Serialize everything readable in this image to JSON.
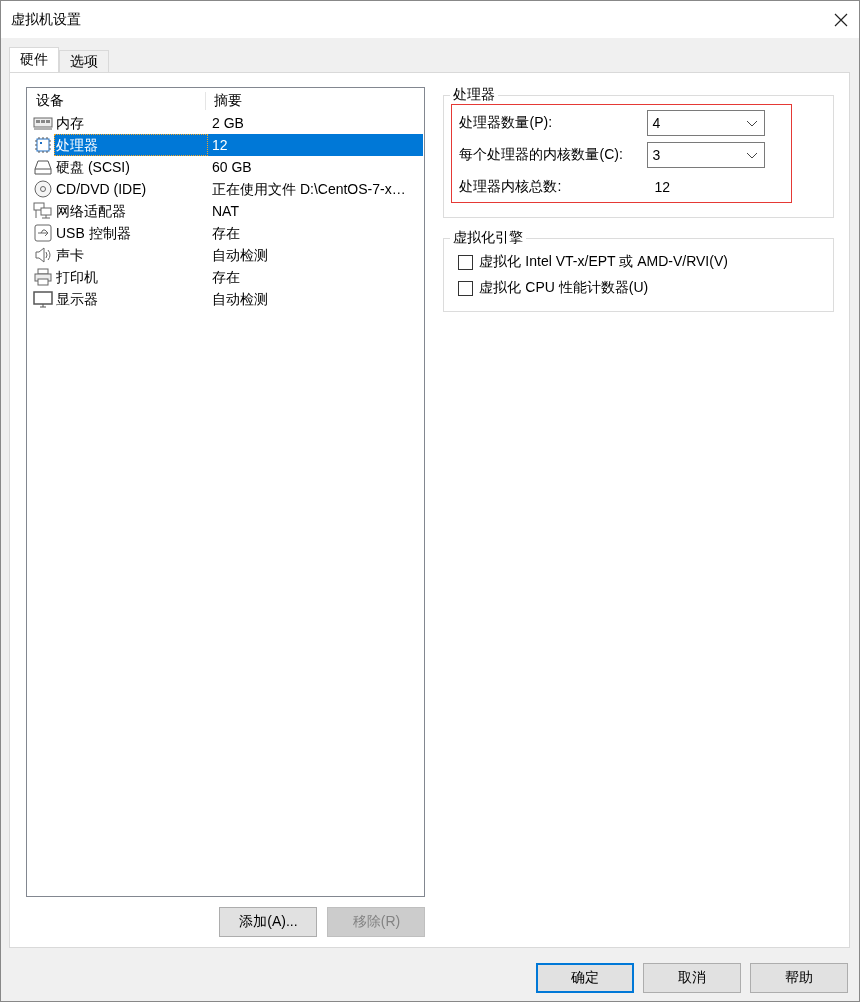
{
  "window": {
    "title": "虚拟机设置"
  },
  "tabs": [
    {
      "label": "硬件",
      "selected": true
    },
    {
      "label": "选项",
      "selected": false
    }
  ],
  "device_list": {
    "columns": [
      "设备",
      "摘要"
    ],
    "rows": [
      {
        "kind": "memory",
        "device": "内存",
        "summary": "2 GB",
        "selected": false
      },
      {
        "kind": "processor",
        "device": "处理器",
        "summary": "12",
        "selected": true
      },
      {
        "kind": "disk",
        "device": "硬盘 (SCSI)",
        "summary": "60 GB",
        "selected": false
      },
      {
        "kind": "cd",
        "device": "CD/DVD (IDE)",
        "summary": "正在使用文件 D:\\CentOS-7-x…",
        "selected": false
      },
      {
        "kind": "network",
        "device": "网络适配器",
        "summary": "NAT",
        "selected": false
      },
      {
        "kind": "usb",
        "device": "USB 控制器",
        "summary": "存在",
        "selected": false
      },
      {
        "kind": "sound",
        "device": "声卡",
        "summary": "自动检测",
        "selected": false
      },
      {
        "kind": "printer",
        "device": "打印机",
        "summary": "存在",
        "selected": false
      },
      {
        "kind": "display",
        "device": "显示器",
        "summary": "自动检测",
        "selected": false
      }
    ]
  },
  "list_buttons": [
    {
      "label": "添加(A)...",
      "disabled": false
    },
    {
      "label": "移除(R)",
      "disabled": true
    }
  ],
  "processor_group": {
    "title": "处理器",
    "highlighted": true,
    "fields": [
      {
        "kind": "combo",
        "label": "处理器数量(P):",
        "value": "4"
      },
      {
        "kind": "combo",
        "label": "每个处理器的内核数量(C):",
        "value": "3"
      },
      {
        "kind": "readout",
        "label": "处理器内核总数:",
        "value": "12"
      }
    ]
  },
  "virtualization_group": {
    "title": "虚拟化引擎",
    "options": [
      {
        "label": "虚拟化 Intel VT-x/EPT 或 AMD-V/RVI(V)",
        "checked": false
      },
      {
        "label": "虚拟化 CPU 性能计数器(U)",
        "checked": false
      }
    ]
  },
  "dialog_buttons": [
    {
      "label": "确定",
      "default": true
    },
    {
      "label": "取消",
      "default": false
    },
    {
      "label": "帮助",
      "default": false
    }
  ]
}
